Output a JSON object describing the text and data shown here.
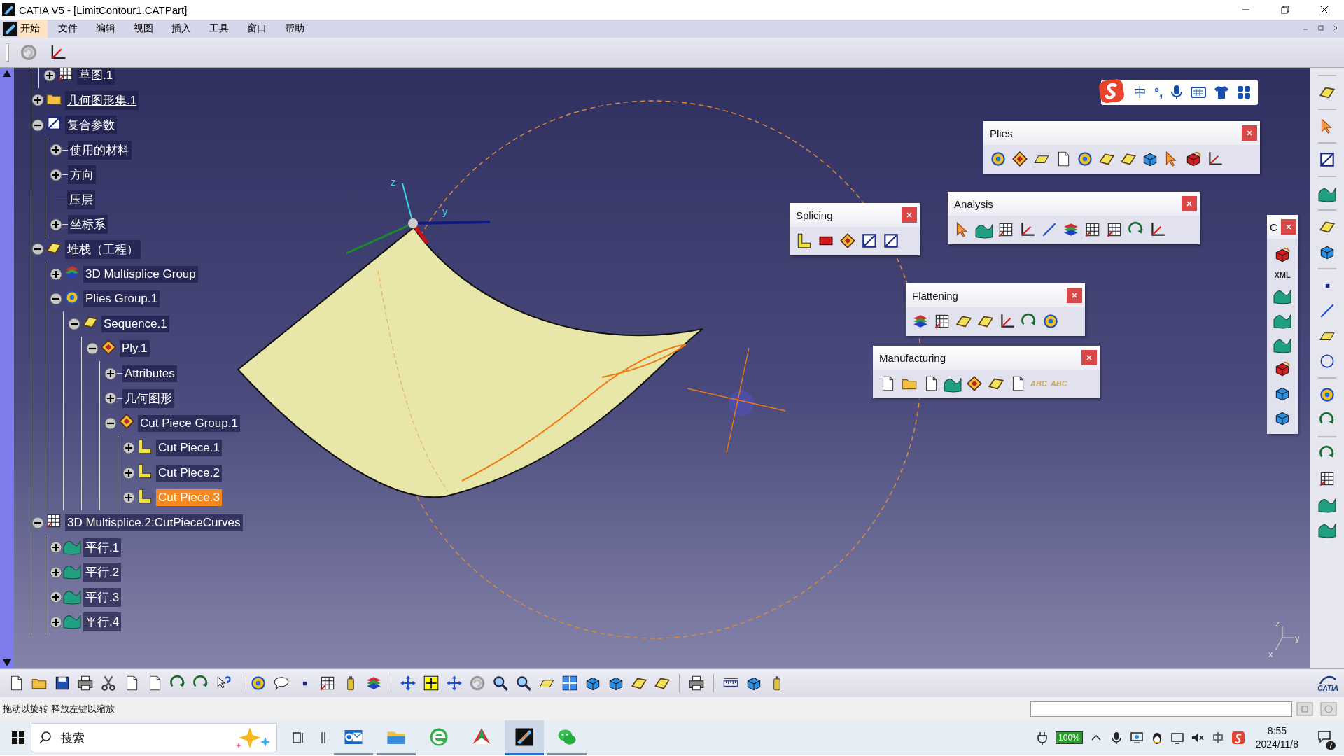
{
  "window": {
    "title": "CATIA V5 - [LimitContour1.CATPart]"
  },
  "menu": [
    {
      "label": "开始",
      "selected": true
    },
    {
      "label": "文件",
      "selected": false
    },
    {
      "label": "编辑",
      "selected": false
    },
    {
      "label": "视图",
      "selected": false
    },
    {
      "label": "插入",
      "selected": false
    },
    {
      "label": "工具",
      "selected": false
    },
    {
      "label": "窗口",
      "selected": false
    },
    {
      "label": "帮助",
      "selected": false
    }
  ],
  "tree": {
    "continued_children": [
      {
        "label": "草图.1",
        "kind": "sketch",
        "expanded": false,
        "selected": false,
        "in_work": false
      }
    ],
    "items": [
      {
        "label": "几何图形集.1",
        "kind": "geoset",
        "expanded": false,
        "selected": false,
        "in_work": true
      },
      {
        "label": "复合参数",
        "kind": "params",
        "expanded": true,
        "selected": false,
        "in_work": false,
        "children": [
          {
            "label": "使用的材料",
            "kind": "plain",
            "expanded": false,
            "selected": false,
            "in_work": false
          },
          {
            "label": "方向",
            "kind": "plain",
            "expanded": false,
            "selected": false,
            "in_work": false
          },
          {
            "label": "压层",
            "kind": "leaf",
            "selected": false,
            "in_work": false
          },
          {
            "label": "坐标系",
            "kind": "plain",
            "expanded": false,
            "selected": false,
            "in_work": false
          }
        ]
      },
      {
        "label": "堆栈（工程）",
        "kind": "stack",
        "expanded": true,
        "selected": false,
        "in_work": false,
        "children": [
          {
            "label": "3D Multisplice Group",
            "kind": "splicegroup",
            "expanded": false,
            "selected": false,
            "in_work": false
          },
          {
            "label": "Plies Group.1",
            "kind": "plies",
            "expanded": true,
            "selected": false,
            "in_work": false,
            "children": [
              {
                "label": "Sequence.1",
                "kind": "sequence",
                "expanded": true,
                "selected": false,
                "in_work": false,
                "children": [
                  {
                    "label": "Ply.1",
                    "kind": "ply",
                    "expanded": true,
                    "selected": false,
                    "in_work": false,
                    "children": [
                      {
                        "label": "Attributes",
                        "kind": "plain",
                        "expanded": false,
                        "selected": false,
                        "in_work": false
                      },
                      {
                        "label": "几何图形",
                        "kind": "plain",
                        "expanded": false,
                        "selected": false,
                        "in_work": false
                      },
                      {
                        "label": "Cut Piece Group.1",
                        "kind": "cutgroup",
                        "expanded": true,
                        "selected": false,
                        "in_work": false,
                        "children": [
                          {
                            "label": "Cut Piece.1",
                            "kind": "cutpiece",
                            "expanded": false,
                            "selected": false,
                            "in_work": false
                          },
                          {
                            "label": "Cut Piece.2",
                            "kind": "cutpiece",
                            "expanded": false,
                            "selected": false,
                            "in_work": false
                          },
                          {
                            "label": "Cut Piece.3",
                            "kind": "cutpiece",
                            "expanded": false,
                            "selected": true,
                            "in_work": false
                          }
                        ]
                      }
                    ]
                  }
                ]
              }
            ]
          }
        ]
      },
      {
        "label": "3D Multisplice.2:CutPieceCurves",
        "kind": "multisplice",
        "expanded": true,
        "selected": false,
        "in_work": false,
        "children": [
          {
            "label": "平行.1",
            "kind": "parallel",
            "expanded": false,
            "selected": false,
            "in_work": false
          },
          {
            "label": "平行.2",
            "kind": "parallel",
            "expanded": false,
            "selected": false,
            "in_work": false
          },
          {
            "label": "平行.3",
            "kind": "parallel",
            "expanded": false,
            "selected": false,
            "in_work": false
          },
          {
            "label": "平行.4",
            "kind": "parallel",
            "expanded": false,
            "selected": false,
            "in_work": false
          }
        ]
      }
    ]
  },
  "viewport": {
    "compass_labels": [
      "z",
      "y"
    ],
    "triad_labels": [
      "z",
      "y",
      "x"
    ]
  },
  "ime_bar": {
    "mode": "中",
    "punctuation": "°,"
  },
  "floating_toolbars": [
    {
      "title": "Plies"
    },
    {
      "title": "Analysis"
    },
    {
      "title": "Splicing"
    },
    {
      "title": "Flattening"
    },
    {
      "title": "Manufacturing",
      "icon_texts": [
        "ABC",
        "ABC"
      ]
    },
    {
      "title": "C",
      "icon_texts": [
        "XML"
      ]
    }
  ],
  "brand": "CATIA",
  "status_bar": {
    "message": "拖动以旋转 释放左键以缩放"
  },
  "taskbar": {
    "placeholder": "搜索",
    "apps": [
      {
        "running": true,
        "selected": false
      },
      {
        "running": true,
        "selected": false
      },
      {
        "running": false,
        "selected": false
      },
      {
        "running": false,
        "selected": false
      },
      {
        "running": true,
        "selected": true
      },
      {
        "running": true,
        "selected": false
      }
    ],
    "battery": "100%",
    "time": "8:55",
    "date": "2024/11/8",
    "notifications": "7"
  }
}
